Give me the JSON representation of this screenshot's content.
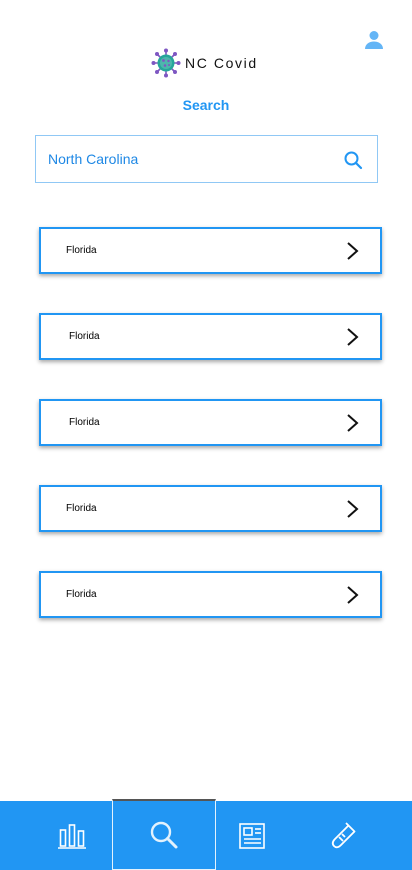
{
  "header": {
    "app_name": "NC Covid",
    "profile_icon": "person-icon",
    "logo_icon": "virus-icon"
  },
  "search": {
    "title": "Search",
    "value": "North Carolina",
    "icon": "search-icon"
  },
  "results": [
    {
      "label": "Florida"
    },
    {
      "label": "Florida"
    },
    {
      "label": "Florida"
    },
    {
      "label": "Florida"
    },
    {
      "label": "Florida"
    }
  ],
  "bottom_nav": {
    "items": [
      {
        "icon": "bar-chart-icon",
        "active": false
      },
      {
        "icon": "search-icon",
        "active": true
      },
      {
        "icon": "newspaper-icon",
        "active": false
      },
      {
        "icon": "test-tube-icon",
        "active": false
      }
    ]
  },
  "colors": {
    "accent": "#2196f3",
    "input_border": "#90c8f5",
    "logo_dots": "#7e57c2",
    "logo_teal": "#26a69a"
  }
}
